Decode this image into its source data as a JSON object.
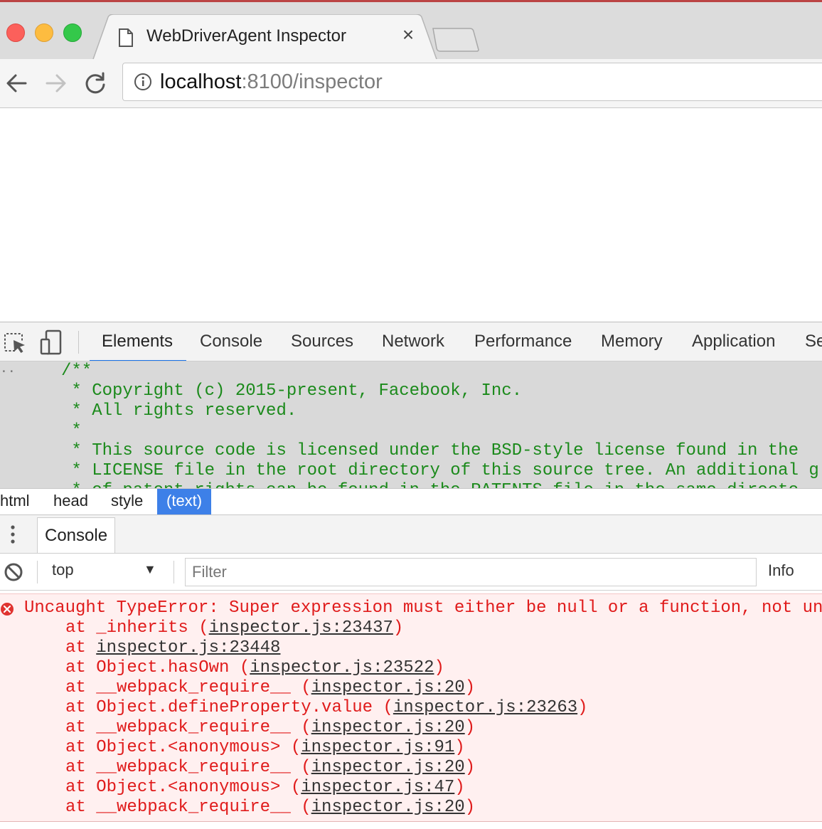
{
  "browser": {
    "tab_title": "WebDriverAgent Inspector",
    "tab_close": "×",
    "url_host": "localhost",
    "url_path": ":8100/inspector"
  },
  "devtools": {
    "tabs": [
      "Elements",
      "Console",
      "Sources",
      "Network",
      "Performance",
      "Memory",
      "Application",
      "Se"
    ],
    "active_tab": "Elements",
    "ellipsis": "··",
    "source_lines": [
      "/**",
      " * Copyright (c) 2015-present, Facebook, Inc.",
      " * All rights reserved.",
      " *",
      " * This source code is licensed under the BSD-style license found in the",
      " * LICENSE file in the root directory of this source tree. An additional g",
      " * of patent rights can be found in the PATENTS file in the same directo"
    ],
    "breadcrumb": [
      "html",
      "head",
      "style",
      "(text)"
    ],
    "drawer_tab": "Console",
    "console_toolbar": {
      "context": "top",
      "context_arrow": "▼",
      "filter_placeholder": "Filter",
      "level": "Info"
    },
    "error": {
      "message": "Uncaught TypeError: Super expression must either be null or a function, not un",
      "stack": [
        {
          "prefix": "at _inherits (",
          "link": "inspector.js:23437",
          "suffix": ")"
        },
        {
          "prefix": "at ",
          "link": "inspector.js:23448",
          "suffix": ""
        },
        {
          "prefix": "at Object.hasOwn (",
          "link": "inspector.js:23522",
          "suffix": ")"
        },
        {
          "prefix": "at __webpack_require__ (",
          "link": "inspector.js:20",
          "suffix": ")"
        },
        {
          "prefix": "at Object.defineProperty.value (",
          "link": "inspector.js:23263",
          "suffix": ")"
        },
        {
          "prefix": "at __webpack_require__ (",
          "link": "inspector.js:20",
          "suffix": ")"
        },
        {
          "prefix": "at Object.<anonymous> (",
          "link": "inspector.js:91",
          "suffix": ")"
        },
        {
          "prefix": "at __webpack_require__ (",
          "link": "inspector.js:20",
          "suffix": ")"
        },
        {
          "prefix": "at Object.<anonymous> (",
          "link": "inspector.js:47",
          "suffix": ")"
        },
        {
          "prefix": "at __webpack_require__ (",
          "link": "inspector.js:20",
          "suffix": ")"
        }
      ]
    }
  },
  "colors": {
    "active_tab_underline": "#1a73e8",
    "breadcrumb_active": "#3d80e8",
    "code_comment": "#1b8a1b",
    "error_text": "#e01b1b",
    "error_background": "#fff0f0"
  },
  "icons": {
    "window_controls": [
      "close-light-icon",
      "minimize-light-icon",
      "maximize-light-icon"
    ],
    "tab": [
      "page-icon",
      "close-icon",
      "new-tab-icon"
    ],
    "toolbar": [
      "back-arrow-icon",
      "forward-arrow-icon",
      "reload-icon",
      "info-icon"
    ],
    "devtools": [
      "inspect-element-icon",
      "device-toolbar-icon",
      "drawer-menu-icon",
      "clear-console-icon",
      "error-icon"
    ]
  }
}
